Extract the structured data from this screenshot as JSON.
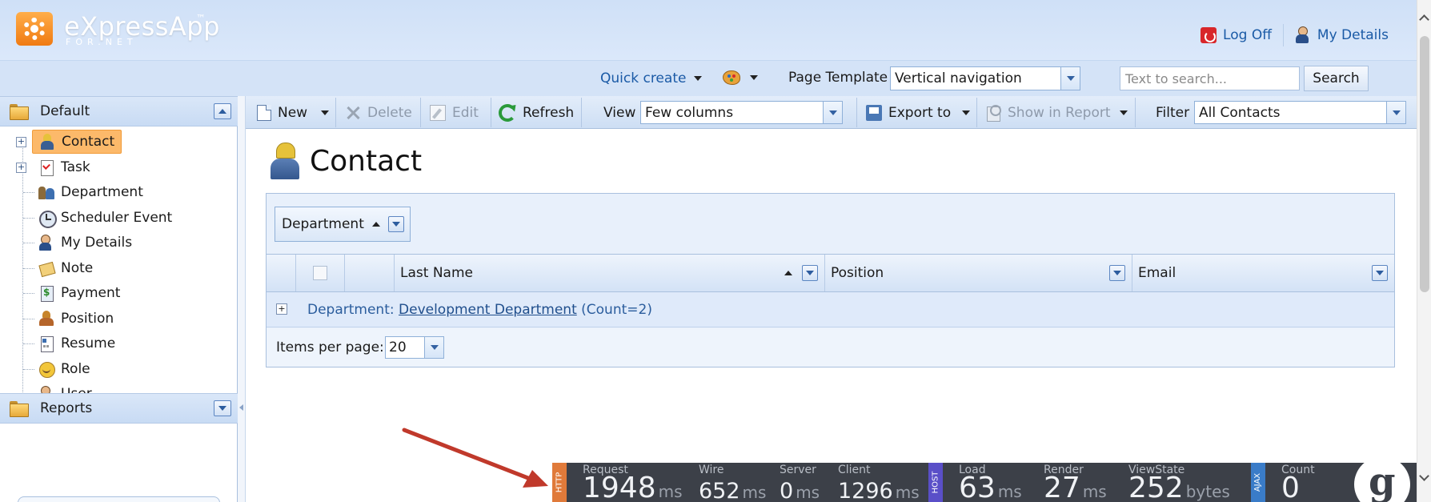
{
  "app": {
    "logo_text": "eXpressApp",
    "logo_tm": "™",
    "logo_sub": "FOR.NET"
  },
  "header": {
    "logoff_label": "Log Off",
    "mydetails_label": "My Details"
  },
  "subheader": {
    "quick_create_label": "Quick create",
    "page_template_label": "Page Template",
    "page_template_value": "Vertical navigation",
    "search_placeholder": "Text to search...",
    "search_button": "Search"
  },
  "navigation": {
    "default_group": "Default",
    "reports_group": "Reports",
    "items": [
      {
        "label": "Contact",
        "icon": "contact-icon",
        "selected": true,
        "expandable": true
      },
      {
        "label": "Task",
        "icon": "task-icon",
        "selected": false,
        "expandable": true
      },
      {
        "label": "Department",
        "icon": "department-icon",
        "selected": false,
        "expandable": false
      },
      {
        "label": "Scheduler Event",
        "icon": "scheduler-icon",
        "selected": false,
        "expandable": false
      },
      {
        "label": "My Details",
        "icon": "my-details-icon",
        "selected": false,
        "expandable": false
      },
      {
        "label": "Note",
        "icon": "note-icon",
        "selected": false,
        "expandable": false
      },
      {
        "label": "Payment",
        "icon": "payment-icon",
        "selected": false,
        "expandable": false
      },
      {
        "label": "Position",
        "icon": "position-icon",
        "selected": false,
        "expandable": false
      },
      {
        "label": "Resume",
        "icon": "resume-icon",
        "selected": false,
        "expandable": false
      },
      {
        "label": "Role",
        "icon": "role-icon",
        "selected": false,
        "expandable": false
      },
      {
        "label": "User",
        "icon": "user-icon",
        "selected": false,
        "expandable": false
      }
    ]
  },
  "toolbar": {
    "new_label": "New",
    "delete_label": "Delete",
    "edit_label": "Edit",
    "refresh_label": "Refresh",
    "view_label": "View",
    "view_value": "Few columns",
    "export_label": "Export to",
    "show_report_label": "Show in Report",
    "filter_label": "Filter",
    "filter_value": "All Contacts"
  },
  "main": {
    "title": "Contact",
    "group_by_column": "Department",
    "columns": [
      "Last Name",
      "Position",
      "Email"
    ],
    "group_row": {
      "prefix": "Department:",
      "link": "Development Department",
      "count": "(Count=2)"
    },
    "pager": {
      "label": "Items per page:",
      "value": "20"
    }
  },
  "perfbar": {
    "http_tag": "HTTP",
    "host_tag": "HOST",
    "ajax_tag": "AJAX",
    "request_label": "Request",
    "request_value": "1948",
    "request_unit": "ms",
    "wire_label": "Wire",
    "wire_value": "652",
    "wire_unit": "ms",
    "server_label": "Server",
    "server_value": "0",
    "server_unit": "ms",
    "client_label": "Client",
    "client_value": "1296",
    "client_unit": "ms",
    "load_label": "Load",
    "load_value": "63",
    "load_unit": "ms",
    "render_label": "Render",
    "render_value": "27",
    "render_unit": "ms",
    "viewstate_label": "ViewState",
    "viewstate_value": "252",
    "viewstate_unit": "bytes",
    "count_label": "Count",
    "count_value": "0",
    "logo_letter": "g"
  },
  "colors": {
    "accent": "#1a5aa6",
    "selected": "#fcb96a",
    "http_tag": "#e07a3a",
    "host_tag": "#5a4fc8",
    "ajax_tag": "#3a7cc8",
    "arrow": "#c0392b"
  }
}
